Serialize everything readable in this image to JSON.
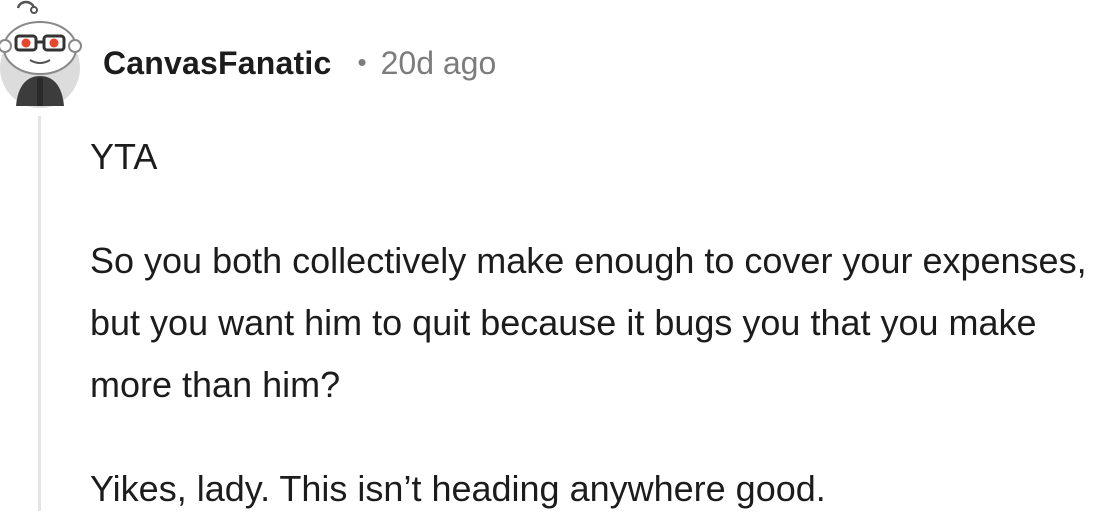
{
  "comment": {
    "author": "CanvasFanatic",
    "separator": "•",
    "timestamp": "20d ago",
    "avatar_icon": "snoo-avatar-icon",
    "paragraphs": [
      "YTA",
      "So you both collectively make enough to cover your expenses, but you want him to quit because it bugs you that you make more than him?",
      "Yikes, lady. This isn’t heading anywhere good."
    ]
  },
  "colors": {
    "text": "#1c1c1c",
    "meta": "#7c7c7c",
    "thread_line": "#e4e4e4",
    "avatar_glasses": "#e8452c"
  }
}
